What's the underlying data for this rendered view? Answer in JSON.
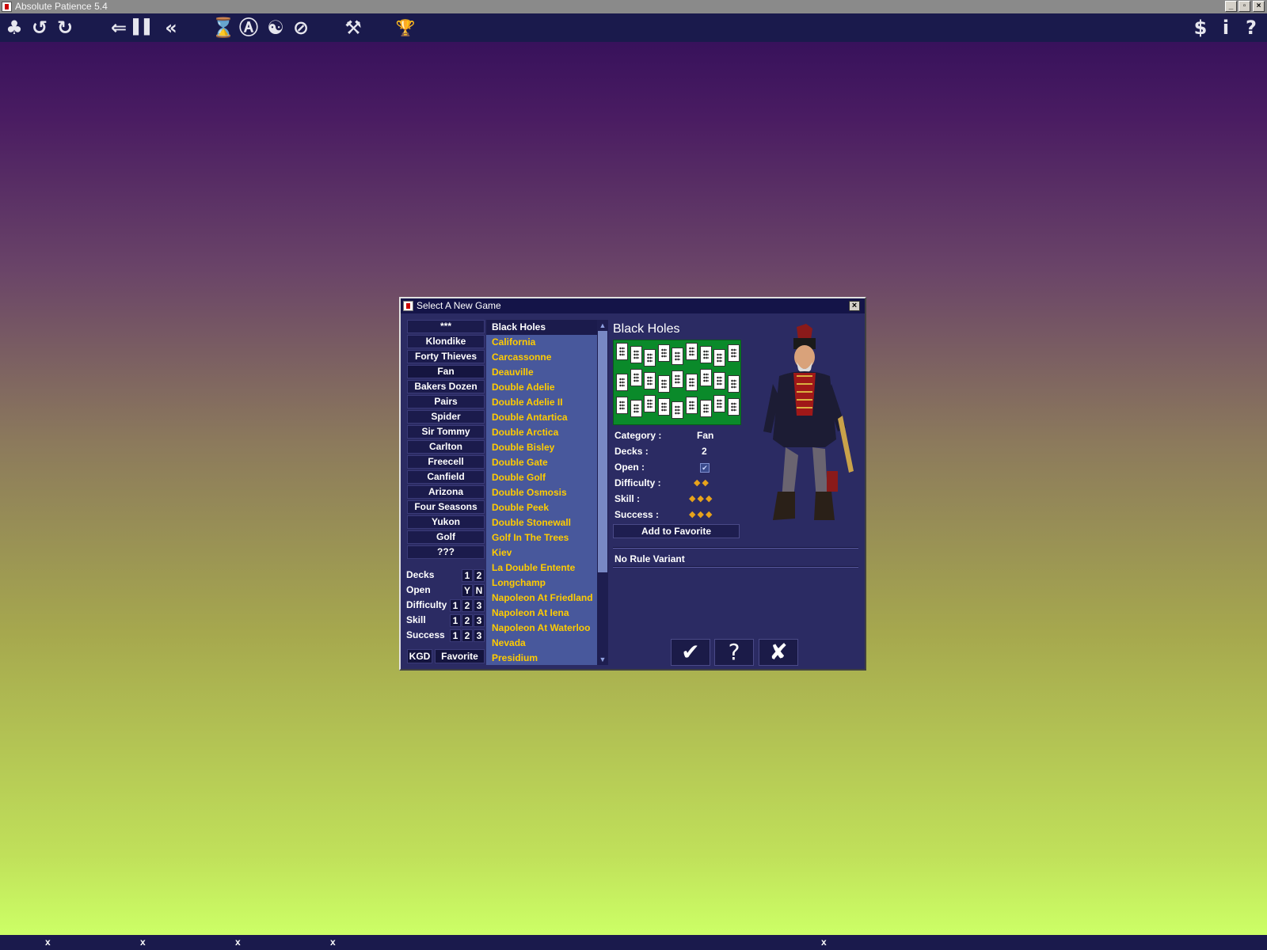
{
  "window": {
    "title": "Absolute Patience 5.4",
    "min_label": "_",
    "max_label": "▫",
    "close_label": "×"
  },
  "toolbar": {
    "new_game": "♣",
    "undo": "↺",
    "redo": "↻",
    "back": "⇐",
    "pause": "▌▌",
    "rewind": "«",
    "timer": "⌛",
    "auto": "Ⓐ",
    "hint": "☯",
    "stop": "⊘",
    "settings": "⚒",
    "trophy": "🏆",
    "buy": "$",
    "info": "i",
    "help": "?"
  },
  "dialog": {
    "title": "Select A New Game",
    "close_label": "×",
    "categories": [
      "***",
      "Klondike",
      "Forty Thieves",
      "Fan",
      "Bakers Dozen",
      "Pairs",
      "Spider",
      "Sir Tommy",
      "Carlton",
      "Freecell",
      "Canfield",
      "Arizona",
      "Four Seasons",
      "Yukon",
      "Golf",
      "???"
    ],
    "selected_category": "Fan",
    "filters": {
      "decks": {
        "label": "Decks",
        "options": [
          "1",
          "2"
        ]
      },
      "open": {
        "label": "Open",
        "options": [
          "Y",
          "N"
        ]
      },
      "difficulty": {
        "label": "Difficulty",
        "options": [
          "1",
          "2",
          "3"
        ]
      },
      "skill": {
        "label": "Skill",
        "options": [
          "1",
          "2",
          "3"
        ]
      },
      "success": {
        "label": "Success",
        "options": [
          "1",
          "2",
          "3"
        ]
      }
    },
    "kgd_label": "KGD",
    "favorite_label": "Favorite",
    "games": [
      "Black Holes",
      "California",
      "Carcassonne",
      "Deauville",
      "Double Adelie",
      "Double Adelie II",
      "Double Antartica",
      "Double Arctica",
      "Double Bisley",
      "Double Gate",
      "Double Golf",
      "Double Osmosis",
      "Double Peek",
      "Double Stonewall",
      "Golf In The Trees",
      "Kiev",
      "La Double Entente",
      "Longchamp",
      "Napoleon At Friedland",
      "Napoleon At Iena",
      "Napoleon At Waterloo",
      "Nevada",
      "Presidium"
    ],
    "selected_game": "Black Holes",
    "details": {
      "title": "Black Holes",
      "category_label": "Category :",
      "category_value": "Fan",
      "decks_label": "Decks :",
      "decks_value": "2",
      "open_label": "Open :",
      "open_checked": true,
      "difficulty_label": "Difficulty :",
      "difficulty_level": 2,
      "skill_label": "Skill :",
      "skill_level": 3,
      "success_label": "Success :",
      "success_level": 3,
      "add_favorite": "Add to Favorite",
      "rule_variant": "No Rule Variant"
    },
    "actions": {
      "ok": "✔",
      "help": "?",
      "cancel": "✘"
    }
  },
  "statusbar": {
    "markers": [
      "x",
      "x",
      "x",
      "x",
      "x"
    ]
  },
  "colors": {
    "accent": "#ffcc00",
    "panel": "#2b2b63",
    "list": "#48589c",
    "toolbar": "#1a1a4c"
  }
}
